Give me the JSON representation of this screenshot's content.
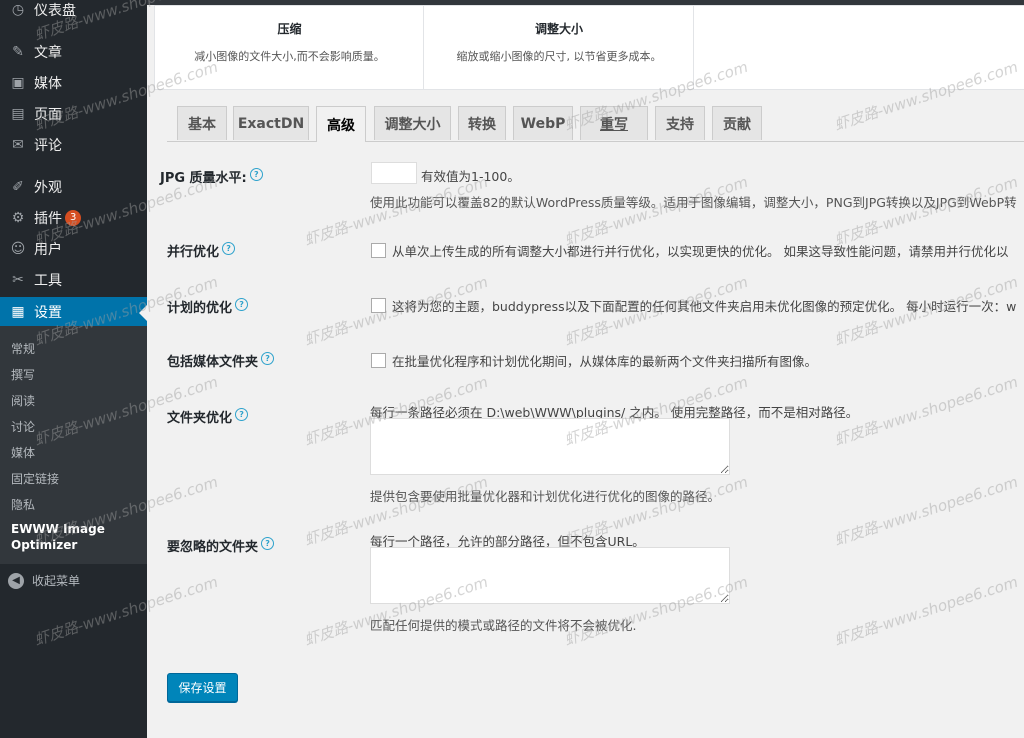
{
  "sidebar": {
    "items": [
      {
        "label": "仪表盘",
        "icon": "dashboard-icon",
        "glyph": "◷"
      },
      {
        "label": "文章",
        "icon": "pin-icon",
        "glyph": "✎"
      },
      {
        "label": "媒体",
        "icon": "media-icon",
        "glyph": "▣"
      },
      {
        "label": "页面",
        "icon": "page-icon",
        "glyph": "▤"
      },
      {
        "label": "评论",
        "icon": "comment-icon",
        "glyph": "✉"
      },
      {
        "label": "外观",
        "icon": "appearance-icon",
        "glyph": "✐"
      },
      {
        "label": "插件",
        "icon": "plugin-icon",
        "glyph": "⚙",
        "badge": "3"
      },
      {
        "label": "用户",
        "icon": "user-icon",
        "glyph": "☺"
      },
      {
        "label": "工具",
        "icon": "tools-icon",
        "glyph": "✂"
      },
      {
        "label": "设置",
        "icon": "settings-icon",
        "glyph": "▦"
      }
    ],
    "submenu": [
      "常规",
      "撰写",
      "阅读",
      "讨论",
      "媒体",
      "固定链接",
      "隐私",
      "EWWW Image Optimizer"
    ],
    "collapse": "收起菜单"
  },
  "cards": [
    {
      "title": "压缩",
      "desc": "减小图像的文件大小,而不会影响质量。"
    },
    {
      "title": "调整大小",
      "desc": "缩放或缩小图像的尺寸, 以节省更多成本。"
    }
  ],
  "tabs": [
    "基本",
    "ExactDN",
    "高级",
    "调整大小",
    "转换",
    "WebP",
    "重写",
    "支持",
    "贡献"
  ],
  "active_tab": "高级",
  "form": {
    "jpg_quality": {
      "label": "JPG 质量水平:",
      "hint": "有效值为1-100。",
      "value": "",
      "desc": "使用此功能可以覆盖82的默认WordPress质量等级。适用于图像编辑，调整大小，PNG到JPG转换以及JPG到WebP转"
    },
    "parallel": {
      "label": "并行优化",
      "desc": "从单次上传生成的所有调整大小都进行并行优化，以实现更快的优化。 如果这导致性能问题，请禁用并行优化以"
    },
    "scheduled": {
      "label": "计划的优化",
      "desc": "这将为您的主题，buddypress以及下面配置的任何其他文件夹启用未优化图像的预定优化。 每小时运行一次：w"
    },
    "media_folders": {
      "label": "包括媒体文件夹",
      "desc": "在批量优化程序和计划优化期间，从媒体库的最新两个文件夹扫描所有图像。"
    },
    "folder_opt": {
      "label": "文件夹优化",
      "hint": "每行一条路径必须在 D:\\web\\WWW\\plugins/ 之内。 使用完整路径，而不是相对路径。",
      "value": "",
      "desc": "提供包含要使用批量优化器和计划优化进行优化的图像的路径。"
    },
    "exclude": {
      "label": "要忽略的文件夹",
      "hint": "每行一个路径，允许的部分路径，但不包含URL。",
      "value": "",
      "desc": "匹配任何提供的模式或路径的文件将不会被优化."
    }
  },
  "save_label": "保存设置",
  "watermark": "虾皮路-www.shopee6.com",
  "colors": {
    "sidebar": "#23282d",
    "accent": "#0073aa",
    "button": "#0085ba",
    "badge": "#d54e21"
  }
}
